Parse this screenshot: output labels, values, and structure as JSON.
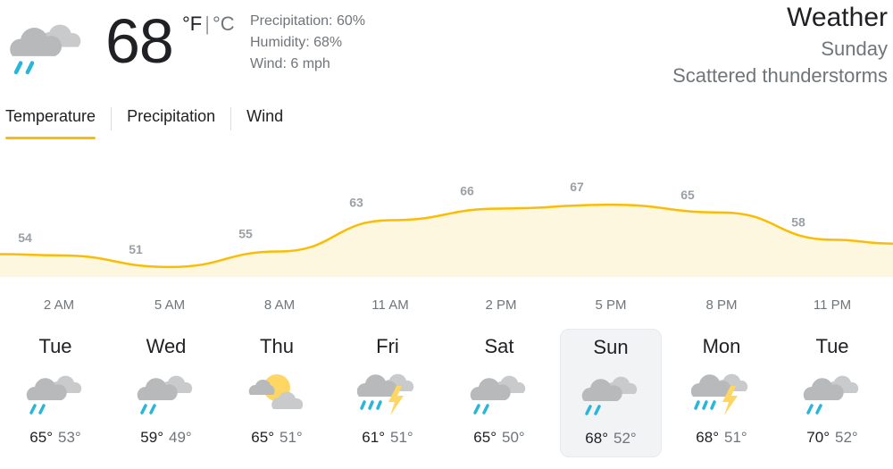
{
  "current": {
    "icon": "cloud-rain-icon",
    "temp": "68",
    "unit_f": "°F",
    "unit_c": "°C",
    "precipitation": "Precipitation: 60%",
    "humidity": "Humidity: 68%",
    "wind": "Wind: 6 mph"
  },
  "header": {
    "title": "Weather",
    "day": "Sunday",
    "condition": "Scattered thunderstorms"
  },
  "tabs": [
    {
      "label": "Temperature",
      "active": true
    },
    {
      "label": "Precipitation",
      "active": false
    },
    {
      "label": "Wind",
      "active": false
    }
  ],
  "chart_data": {
    "type": "area",
    "x": [
      "2 AM",
      "5 AM",
      "8 AM",
      "11 AM",
      "2 PM",
      "5 PM",
      "8 PM",
      "11 PM"
    ],
    "values": [
      54,
      51,
      55,
      63,
      66,
      67,
      65,
      58
    ],
    "data_labels": [
      "54",
      "51",
      "55",
      "63",
      "66",
      "67",
      "65",
      "58"
    ],
    "title": "",
    "xlabel": "",
    "ylabel": "",
    "grid": false,
    "colors": {
      "line": "#fbbc04",
      "fill": "#fef7e0",
      "label": "#9aa0a6"
    }
  },
  "forecast": [
    {
      "day": "Tue",
      "icon": "cloud-rain-icon",
      "high": "65°",
      "low": "53°",
      "selected": false
    },
    {
      "day": "Wed",
      "icon": "cloud-rain-icon",
      "high": "59°",
      "low": "49°",
      "selected": false
    },
    {
      "day": "Thu",
      "icon": "partly-cloudy-icon",
      "high": "65°",
      "low": "51°",
      "selected": false
    },
    {
      "day": "Fri",
      "icon": "thunderstorm-icon",
      "high": "61°",
      "low": "51°",
      "selected": false
    },
    {
      "day": "Sat",
      "icon": "cloud-rain-icon",
      "high": "65°",
      "low": "50°",
      "selected": false
    },
    {
      "day": "Sun",
      "icon": "cloud-rain-icon",
      "high": "68°",
      "low": "52°",
      "selected": true
    },
    {
      "day": "Mon",
      "icon": "thunderstorm-icon",
      "high": "68°",
      "low": "51°",
      "selected": false
    },
    {
      "day": "Tue",
      "icon": "cloud-rain-icon",
      "high": "70°",
      "low": "52°",
      "selected": false
    }
  ]
}
